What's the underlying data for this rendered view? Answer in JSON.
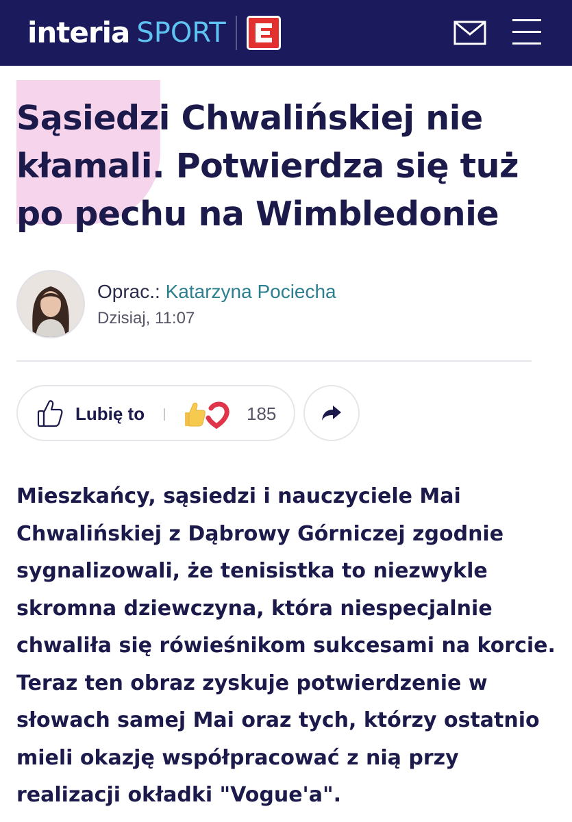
{
  "header": {
    "logo_main": "interia",
    "logo_section": "SPORT",
    "logo_badge": "E",
    "mail_icon": "envelope-icon",
    "menu_icon": "hamburger-menu-icon",
    "background_color": "#1b1a5c",
    "section_color": "#5ec3f0",
    "badge_color": "#e2312f"
  },
  "article": {
    "title": "Sąsiedzi Chwalińskiej nie kłamali. Potwierdza się tuż po pechu na Wimbledonie",
    "author_prefix": "Oprac.:",
    "author_name": "Katarzyna Pociecha",
    "date": "Dzisiaj, 11:07",
    "lead": "Mieszkańcy, sąsiedzi i nauczyciele Mai Chwalińskiej z Dąbrowy Górniczej zgodnie sygnalizowali, że tenisistka to niezwykle skromna dziewczyna, która niespecjalnie chwaliła się rówieśnikom sukcesami na korcie. Teraz ten obraz zyskuje potwierdzenie w słowach samej Mai oraz tych, którzy ostatnio mieli okazję współpracować z nią przy realizacji okładki \"Vogue'a\"."
  },
  "reactions": {
    "like_label": "Lubię to",
    "count": "185",
    "like_icon": "thumbs-up-outline-icon",
    "reaction_icons": [
      "thumbs-up-emoji-icon",
      "heart-icon"
    ],
    "share_icon": "share-arrow-icon"
  },
  "colors": {
    "title": "#1b1a4a",
    "author_link": "#2c7f8e",
    "decoration": "#f6d4ec"
  }
}
